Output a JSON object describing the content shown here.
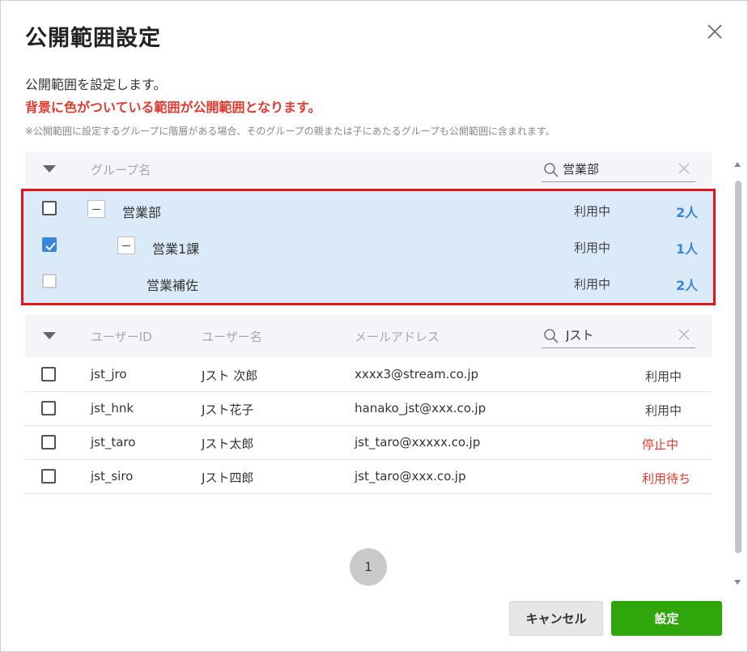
{
  "dialog": {
    "title": "公開範囲設定",
    "description": "公開範囲を設定します。",
    "highlight_text": "背景に色がついている範囲が公開範囲となります。",
    "note": "※公開範囲に設定するグループに階層がある場合、そのグループの親または子にあたるグループも公開範囲に含まれます。"
  },
  "group_table": {
    "header_label": "グループ名",
    "search_value": "営業部",
    "rows": [
      {
        "name": "営業部",
        "status": "利用中",
        "count": "2人",
        "checked": false,
        "disabled": false
      },
      {
        "name": "営業1課",
        "status": "利用中",
        "count": "1人",
        "checked": true,
        "disabled": false
      },
      {
        "name": "営業補佐",
        "status": "利用中",
        "count": "2人",
        "checked": false,
        "disabled": true
      }
    ]
  },
  "user_table": {
    "headers": {
      "user_id": "ユーザーID",
      "user_name": "ユーザー名",
      "email": "メールアドレス"
    },
    "search_value": "Jスト",
    "rows": [
      {
        "id": "jst_jro",
        "name": "Jスト 次郎",
        "email": "xxxx3@stream.co.jp",
        "status": "利用中",
        "status_color": "#444444"
      },
      {
        "id": "jst_hnk",
        "name": "Jスト花子",
        "email": "hanako_jst@xxx.co.jp",
        "status": "利用中",
        "status_color": "#444444"
      },
      {
        "id": "jst_taro",
        "name": "Jスト太郎",
        "email": "jst_taro@xxxxx.co.jp",
        "status": "停止中",
        "status_color": "#e03a2f"
      },
      {
        "id": "jst_siro",
        "name": "Jスト四郎",
        "email": "jst_taro@xxx.co.jp",
        "status": "利用待ち",
        "status_color": "#e03a2f"
      }
    ]
  },
  "pagination": {
    "current_page": "1"
  },
  "buttons": {
    "cancel": "キャンセル",
    "submit": "設定"
  },
  "colors": {
    "accent_blue": "#3a86d8",
    "warning_red": "#e03a2f",
    "submit_green": "#2ea60c",
    "highlight_bg": "#dbeaf8"
  }
}
